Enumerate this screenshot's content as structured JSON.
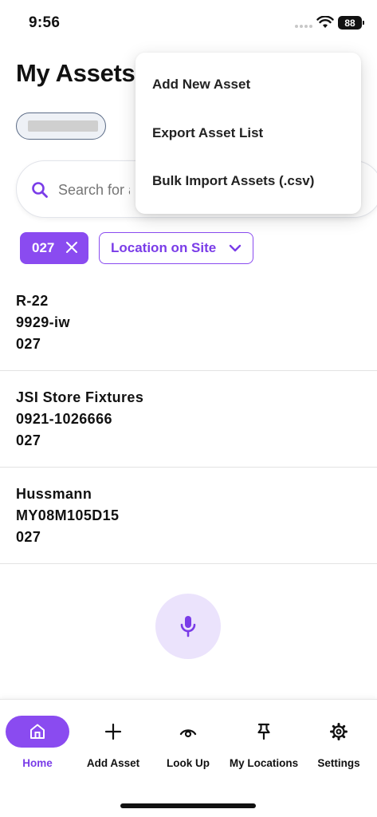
{
  "status_bar": {
    "time": "9:56",
    "battery": "88"
  },
  "page": {
    "title": "My Assets"
  },
  "search": {
    "placeholder": "Search for a"
  },
  "filters": {
    "chip_value": "027",
    "location_label": "Location on Site"
  },
  "assets": [
    {
      "name": "R-22",
      "serial": "9929-iw",
      "site": "027"
    },
    {
      "name": "JSI Store Fixtures",
      "serial": "0921-1026666",
      "site": "027"
    },
    {
      "name": "Hussmann",
      "serial": "MY08M105D15",
      "site": "027"
    }
  ],
  "menu": {
    "items": [
      "Add New Asset",
      "Export Asset List",
      "Bulk Import Assets (.csv)"
    ]
  },
  "nav": {
    "items": [
      {
        "label": "Home",
        "icon": "home-icon",
        "active": true
      },
      {
        "label": "Add Asset",
        "icon": "plus-icon"
      },
      {
        "label": "Look Up",
        "icon": "eye-icon"
      },
      {
        "label": "My Locations",
        "icon": "pin-icon"
      },
      {
        "label": "Settings",
        "icon": "gear-icon"
      }
    ]
  },
  "colors": {
    "accent": "#8a4bf0",
    "accent_text": "#7a3ce8",
    "mic_bg": "#ebe3fc"
  }
}
